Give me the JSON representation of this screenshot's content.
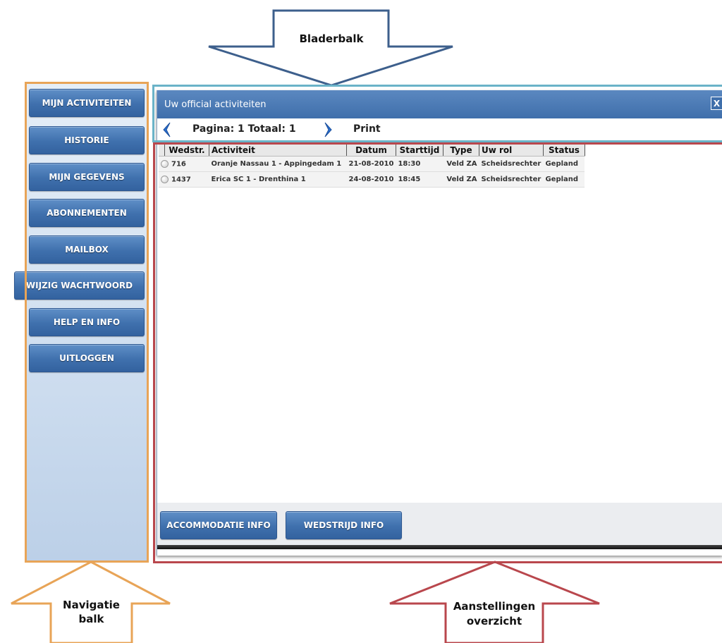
{
  "annotations": {
    "bladerbalk": "Bladerbalk",
    "navigatie_line1": "Navigatie",
    "navigatie_line2": "balk",
    "aanstellingen_line1": "Aanstellingen",
    "aanstellingen_line2": "overzicht",
    "colors": {
      "bladerbalk_outline": "#6ab3c8",
      "navigatie_outline": "#e8a457",
      "aanstellingen_outline": "#b9474d",
      "bladerbalk_arrow": "#3d5f8c"
    }
  },
  "sidebar": {
    "items": [
      {
        "label": "MIJN ACTIVITEITEN"
      },
      {
        "label": "HISTORIE"
      },
      {
        "label": "MIJN GEGEVENS"
      },
      {
        "label": "ABONNEMENTEN"
      },
      {
        "label": "MAILBOX"
      },
      {
        "label": "WIJZIG WACHTWOORD"
      },
      {
        "label": "HELP EN INFO"
      },
      {
        "label": "UITLOGGEN"
      }
    ]
  },
  "window": {
    "title": "Uw official activiteiten",
    "close_label": "X"
  },
  "pager": {
    "text": "Pagina: 1  Totaal: 1",
    "print_label": "Print"
  },
  "table": {
    "columns": [
      "Wedstr.",
      "Activiteit",
      "Datum",
      "Starttijd",
      "Type",
      "Uw rol",
      "Status"
    ],
    "rows": [
      [
        "716",
        "Oranje Nassau 1 - Appingedam 1",
        "21-08-2010",
        "18:30",
        "Veld ZA",
        "Scheidsrechter",
        "Gepland"
      ],
      [
        "1437",
        "Erica SC 1 - Drenthina 1",
        "24-08-2010",
        "18:45",
        "Veld ZA",
        "Scheidsrechter",
        "Gepland"
      ]
    ]
  },
  "footer": {
    "accommodatie_label": "ACCOMMODATIE INFO",
    "wedstrijd_label": "WEDSTRIJD INFO"
  }
}
